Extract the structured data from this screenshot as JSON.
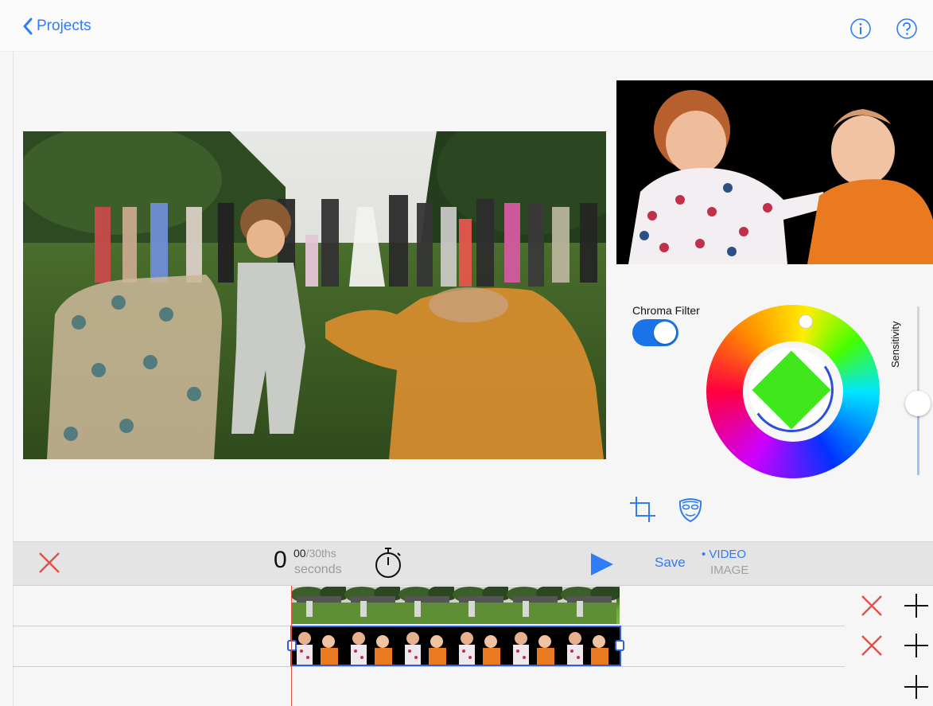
{
  "nav": {
    "back_label": "Projects",
    "info_icon": "info-icon",
    "help_icon": "help-icon"
  },
  "chroma": {
    "label": "Chroma Filter",
    "enabled": true,
    "sensitivity_label": "Sensitivity",
    "sensitivity_level": 0.5,
    "key_color": "#3fe81b"
  },
  "tools": {
    "crop_icon": "crop-icon",
    "mask_icon": "mask-icon"
  },
  "controls": {
    "time_seconds": "0",
    "time_frames": "00",
    "time_frames_unit": "/30ths",
    "time_unit": "seconds",
    "timer_icon": "stopwatch-icon",
    "play_icon": "play-icon",
    "save_label": "Save",
    "mode_video": "• VIDEO",
    "mode_image": "IMAGE",
    "selected_mode": "VIDEO"
  },
  "timeline": {
    "tracks": [
      {
        "clip": "wedding background video",
        "selected": false
      },
      {
        "clip": "children foreground video",
        "selected": true
      },
      {
        "clip": "",
        "selected": false
      }
    ],
    "delete_icon": "delete-icon",
    "add_icon": "plus-icon"
  },
  "colors": {
    "accent": "#2f7cf6",
    "delete": "#e0514a",
    "toggle_on": "#1a74e8"
  }
}
